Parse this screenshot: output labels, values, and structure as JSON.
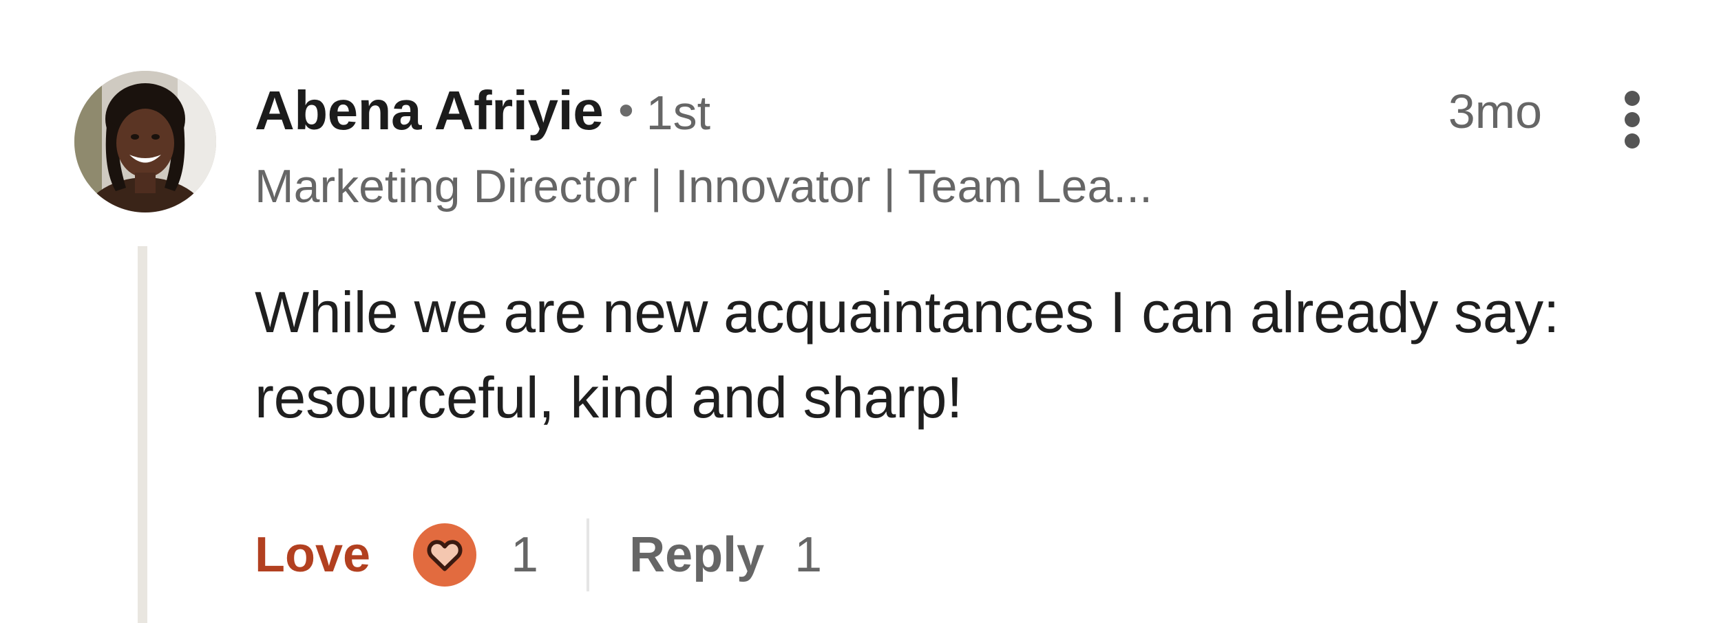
{
  "comment": {
    "author": {
      "name": "Abena Afriyie",
      "separator": "•",
      "connection_degree": "1st",
      "headline": "Marketing Director | Innovator | Team Lea..."
    },
    "timestamp": "3mo",
    "body": "While we are new acquaintances I can already say: resourceful, kind and sharp!",
    "actions": {
      "reaction_label": "Love",
      "reaction_icon": "heart-icon",
      "reaction_count": "1",
      "reply_label": "Reply",
      "reply_count": "1"
    },
    "more_icon": "more-vertical-icon"
  },
  "colors": {
    "reaction_accent": "#b24020",
    "reaction_icon_bg": "#e26b3f",
    "thread_line": "#e9e6e0",
    "secondary_text": "#666666"
  }
}
